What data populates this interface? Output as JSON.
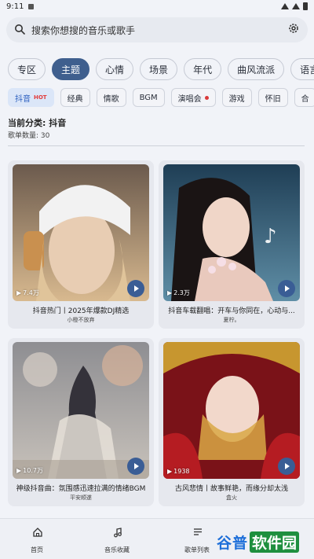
{
  "status": {
    "time": "9:11"
  },
  "search": {
    "placeholder": "搜索你想搜的音乐或歌手"
  },
  "primary_tabs": [
    "专区",
    "主题",
    "心情",
    "场景",
    "年代",
    "曲风流派",
    "语言"
  ],
  "primary_active_index": 1,
  "secondary_tabs": [
    {
      "label": "抖音",
      "badge": "HOT"
    },
    {
      "label": "经典"
    },
    {
      "label": "情歌"
    },
    {
      "label": "BGM"
    },
    {
      "label": "演唱会"
    },
    {
      "label": "游戏"
    },
    {
      "label": "怀旧"
    },
    {
      "label": "合"
    }
  ],
  "current_category": "当前分类: 抖音",
  "playlist_count": "歌单数量: 30",
  "playlists": [
    {
      "title": "抖音热门丨2025年爆款DJ精选",
      "subtitle": "小橙不放弃",
      "plays": "7.4万"
    },
    {
      "title": "抖音车载翻唱：开车与你同在，心动与...",
      "subtitle": "夏柠。",
      "plays": "2.3万"
    },
    {
      "title": "神级抖音曲：氛围感迅速拉满的情绪BGM",
      "subtitle": "平安顺遂",
      "plays": "10.7万"
    },
    {
      "title": "古风悲情丨故事鲜艳，而缘分却太浅",
      "subtitle": "盒火",
      "plays": "1938"
    }
  ],
  "bottom_nav": [
    {
      "label": "首页",
      "icon": "home-icon"
    },
    {
      "label": "音乐收藏",
      "icon": "music-note-icon"
    },
    {
      "label": "歌单列表",
      "icon": "playlist-icon"
    }
  ],
  "watermark": {
    "part1": "谷普",
    "part2": "软件园"
  },
  "colors": {
    "accent": "#3f5f8e",
    "hot": "#e23b3b",
    "play_button": "#3a5d95"
  }
}
